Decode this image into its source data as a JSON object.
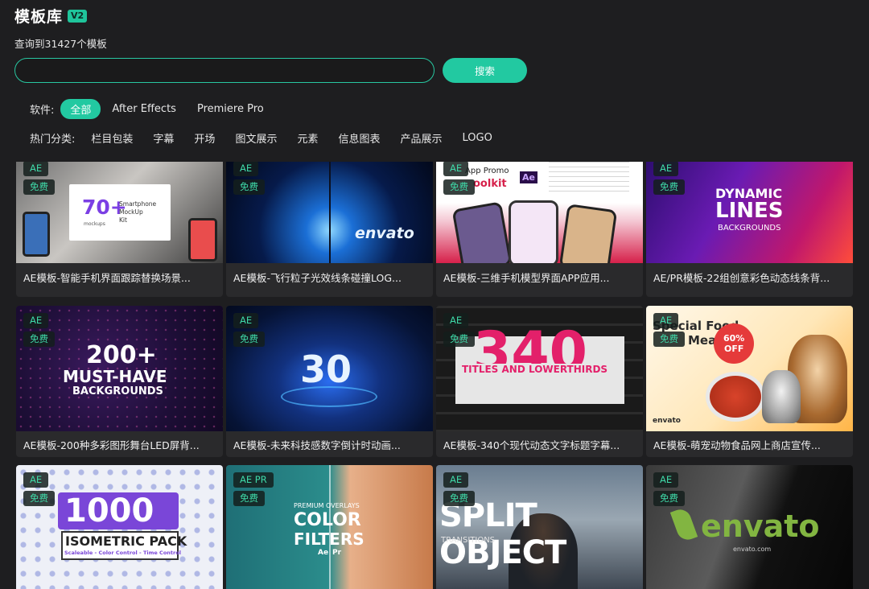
{
  "header": {
    "title": "模板库",
    "version": "V2"
  },
  "result_count": "查询到31427个模板",
  "search": {
    "value": "",
    "placeholder": "",
    "button_label": "搜索"
  },
  "software_filter": {
    "label": "软件:",
    "options": [
      "全部",
      "After Effects",
      "Premiere Pro"
    ],
    "selected": "全部"
  },
  "category_filter": {
    "label": "热门分类:",
    "options": [
      "栏目包装",
      "字幕",
      "开场",
      "图文展示",
      "元素",
      "信息图表",
      "产品展示",
      "LOGO"
    ]
  },
  "colors": {
    "accent": "#22c9a1",
    "background": "#1e1e20",
    "card": "#2a2a2c",
    "badge_text": "#3fd9a8"
  },
  "cards": [
    {
      "software": "AE",
      "price": "免费",
      "title": "AE模板-智能手机界面跟踪替换场景...",
      "thumb_text": [
        "70+",
        "Smartphone",
        "MockUp",
        "Kit",
        "mockups"
      ]
    },
    {
      "software": "AE",
      "price": "免费",
      "title": "AE模板-飞行粒子光效线条碰撞LOG...",
      "thumb_text": [
        "envato"
      ]
    },
    {
      "software": "AE",
      "price": "免费",
      "title": "AE模板-三维手机模型界面APP应用...",
      "thumb_text": [
        "App Promo",
        "oolkit",
        "Ae"
      ]
    },
    {
      "software": "AE",
      "price": "免费",
      "title": "AE/PR模板-22组创意彩色动态线条背...",
      "thumb_text": [
        "DYNAMIC",
        "LINES",
        "BACKGROUNDS"
      ]
    },
    {
      "software": "AE",
      "price": "免费",
      "title": "AE模板-200种多彩图形舞台LED屏背...",
      "thumb_text": [
        "200+",
        "MUST-HAVE",
        "BACKGROUNDS"
      ]
    },
    {
      "software": "AE",
      "price": "免费",
      "title": "AE模板-未来科技感数字倒计时动画...",
      "thumb_text": [
        "30"
      ]
    },
    {
      "software": "AE",
      "price": "免费",
      "title": "AE模板-340个现代动态文字标题字幕...",
      "thumb_text": [
        "340",
        "TITLES AND LOWERTHIRDS"
      ]
    },
    {
      "software": "AE",
      "price": "免费",
      "title": "AE模板-萌宠动物食品网上商店宣传...",
      "thumb_text": [
        "Special Food",
        "Meal",
        "60%",
        "OFF",
        "envato"
      ]
    },
    {
      "software": "AE",
      "price": "免费",
      "title": "",
      "thumb_text": [
        "1000",
        "ISOMETRIC PACK",
        "Scaleable - Color Control - Time Control"
      ]
    },
    {
      "software": "AE PR",
      "price": "免费",
      "title": "",
      "thumb_text": [
        "PREMIUM OVERLAYS",
        "COLOR",
        "FILTERS",
        "Ae",
        "Pr"
      ]
    },
    {
      "software": "AE",
      "price": "免费",
      "title": "",
      "thumb_text": [
        "SPLIT OBJECT",
        "TRANSITIONS"
      ]
    },
    {
      "software": "AE",
      "price": "免费",
      "title": "",
      "thumb_text": [
        "envato",
        "envato.com"
      ]
    }
  ]
}
